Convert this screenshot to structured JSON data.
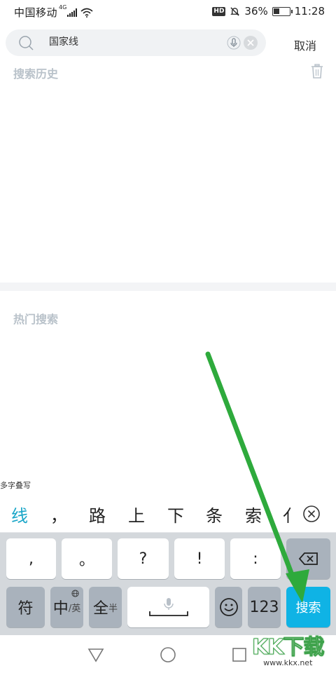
{
  "status_bar": {
    "carrier": "中国移动",
    "network": "4G",
    "hd": "HD",
    "battery": "36%",
    "battery_level": 0.36,
    "time": "11:28"
  },
  "search": {
    "query": "国家线",
    "cancel_label": "取消"
  },
  "history": {
    "title": "搜索历史"
  },
  "hot": {
    "title": "热门搜索"
  },
  "keyboard": {
    "mode_hint": "多字叠写",
    "candidates": [
      "线",
      "，",
      "路",
      "上",
      "下",
      "条",
      "索",
      "亻"
    ],
    "row1": [
      ",",
      "。",
      "?",
      "!",
      ":"
    ],
    "symbols_label": "符",
    "zh_label": "中",
    "en_label": "/英",
    "full_label": "全",
    "half_label": "半",
    "num_label": "123",
    "search_label": "搜索"
  },
  "watermark": {
    "logo": "KK下载",
    "url": "www.kkx.net"
  },
  "colors": {
    "accent": "#0fb3e5",
    "candidate_active": "#1aa6c8",
    "arrow": "#2eaa3c"
  }
}
